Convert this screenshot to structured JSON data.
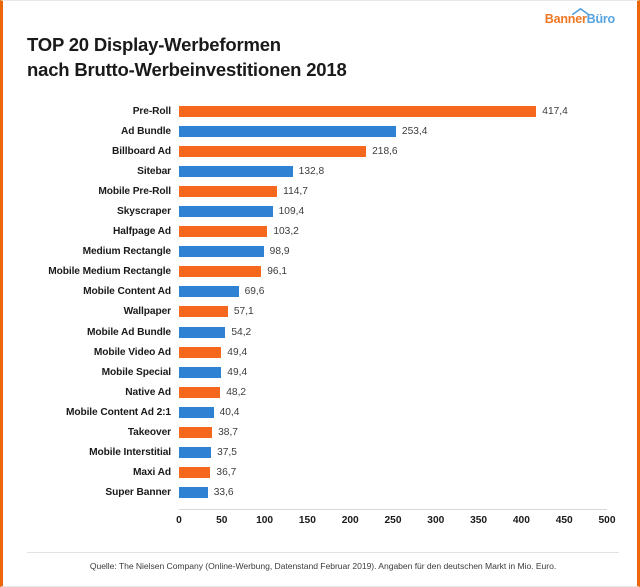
{
  "logo": {
    "part1": "Banner",
    "part2": "Büro",
    "roof_icon": "roof-chevron-icon",
    "color_orange": "#ef7622",
    "color_blue": "#55a3e0"
  },
  "title": {
    "line1": "TOP 20 Display-Werbeformen",
    "line2": "nach Brutto-Werbeinvestitionen 2018"
  },
  "footer": {
    "source": "Quelle: The Nielsen Company (Online-Werbung, Datenstand Februar 2019). Angaben für den deutschen Markt in Mio. Euro."
  },
  "theme": {
    "border_accent": "#ec6608",
    "bar_orange": "#f4671c",
    "bar_blue": "#2f81d4"
  },
  "chart_data": {
    "type": "bar",
    "orientation": "horizontal",
    "title": "TOP 20 Display-Werbeformen nach Brutto-Werbeinvestitionen 2018",
    "xlabel": "",
    "ylabel": "",
    "unit": "Mio. Euro",
    "xlim": [
      0,
      500
    ],
    "xticks": [
      0,
      50,
      100,
      150,
      200,
      250,
      300,
      350,
      400,
      450,
      500
    ],
    "grid": false,
    "legend": "none",
    "value_decimal_separator": ",",
    "categories": [
      "Pre-Roll",
      "Ad Bundle",
      "Billboard Ad",
      "Sitebar",
      "Mobile Pre-Roll",
      "Skyscraper",
      "Halfpage Ad",
      "Medium Rectangle",
      "Mobile Medium Rectangle",
      "Mobile Content Ad",
      "Wallpaper",
      "Mobile Ad Bundle",
      "Mobile Video Ad",
      "Mobile Special",
      "Native Ad",
      "Mobile Content Ad 2:1",
      "Takeover",
      "Mobile Interstitial",
      "Maxi Ad",
      "Super Banner"
    ],
    "values": [
      417.4,
      253.4,
      218.6,
      132.8,
      114.7,
      109.4,
      103.2,
      98.9,
      96.1,
      69.6,
      57.1,
      54.2,
      49.4,
      49.4,
      48.2,
      40.4,
      38.7,
      37.5,
      36.7,
      33.6
    ],
    "value_labels": [
      "417,4",
      "253,4",
      "218,6",
      "132,8",
      "114,7",
      "109,4",
      "103,2",
      "98,9",
      "96,1",
      "69,6",
      "57,1",
      "54,2",
      "49,4",
      "49,4",
      "48,2",
      "40,4",
      "38,7",
      "37,5",
      "36,7",
      "33,6"
    ],
    "colors": [
      "orange",
      "blue",
      "orange",
      "blue",
      "orange",
      "blue",
      "orange",
      "blue",
      "orange",
      "blue",
      "orange",
      "blue",
      "orange",
      "blue",
      "orange",
      "blue",
      "orange",
      "blue",
      "orange",
      "blue"
    ]
  }
}
